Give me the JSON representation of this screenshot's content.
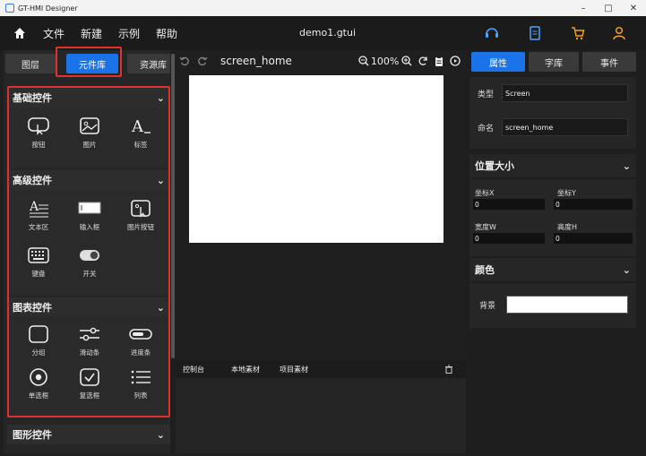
{
  "window": {
    "title": "GT-HMI Designer",
    "minimize": "–",
    "maximize": "□",
    "close": "✕"
  },
  "menu": {
    "items": [
      "文件",
      "新建",
      "示例",
      "帮助"
    ],
    "document": "demo1.gtui"
  },
  "left_tabs": [
    "图层",
    "元件库",
    "资源库"
  ],
  "sections": {
    "basic": {
      "title": "基础控件",
      "items": [
        "按钮",
        "图片",
        "标签"
      ]
    },
    "advanced": {
      "title": "高级控件",
      "items": [
        "文本区",
        "输入框",
        "图片按钮",
        "键盘",
        "开关"
      ]
    },
    "chart": {
      "title": "图表控件",
      "items": [
        "分组",
        "滑动条",
        "进度条",
        "单选框",
        "复选框",
        "列表"
      ]
    },
    "graphic": {
      "title": "图形控件"
    }
  },
  "canvas": {
    "screen_name": "screen_home",
    "zoom": "100%"
  },
  "console_tabs": [
    "控制台",
    "本地素材",
    "项目素材"
  ],
  "right_tabs": [
    "属性",
    "字库",
    "事件"
  ],
  "props": {
    "type_label": "类型",
    "type_value": "Screen",
    "name_label": "命名",
    "name_value": "screen_home"
  },
  "position": {
    "title": "位置大小",
    "x_label": "坐标X",
    "x_value": "0",
    "y_label": "坐标Y",
    "y_value": "0",
    "w_label": "宽度W",
    "w_value": "0",
    "h_label": "高度H",
    "h_value": "0"
  },
  "color": {
    "title": "颜色",
    "bg_label": "背景",
    "bg_value": "#ffffff"
  },
  "colors": {
    "accent": "#1a73e8",
    "highlight": "#e03131",
    "icon_yellow": "#f0a020",
    "icon_blue": "#4da3ff"
  }
}
